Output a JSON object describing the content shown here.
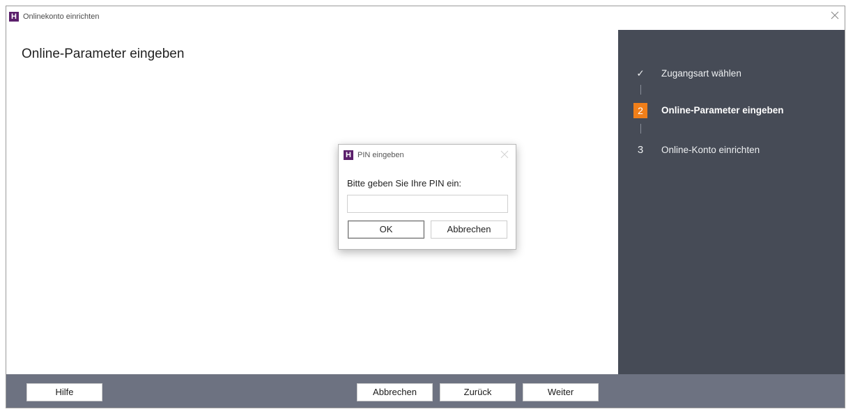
{
  "window": {
    "logo_letter": "H",
    "title": "Onlinekonto einrichten",
    "icons": {
      "app": "app-logo-icon",
      "close": "close-icon"
    }
  },
  "main": {
    "heading": "Online-Parameter eingeben"
  },
  "wizard": {
    "steps": [
      {
        "marker": "✓",
        "label": "Zugangsart wählen",
        "state": "done"
      },
      {
        "marker": "2",
        "label": "Online-Parameter eingeben",
        "state": "active"
      },
      {
        "marker": "3",
        "label": "Online-Konto einrichten",
        "state": "pending"
      }
    ]
  },
  "footer": {
    "help": "Hilfe",
    "cancel": "Abbrechen",
    "back": "Zurück",
    "next": "Weiter"
  },
  "pin_dialog": {
    "logo_letter": "H",
    "title": "PIN eingeben",
    "prompt": "Bitte geben Sie Ihre PIN ein:",
    "pin_value": "",
    "ok": "OK",
    "cancel": "Abbrechen"
  },
  "colors": {
    "accent": "#f07f1a",
    "brand": "#5b1f6b",
    "panel": "#464b56",
    "footer": "#6d7281"
  }
}
